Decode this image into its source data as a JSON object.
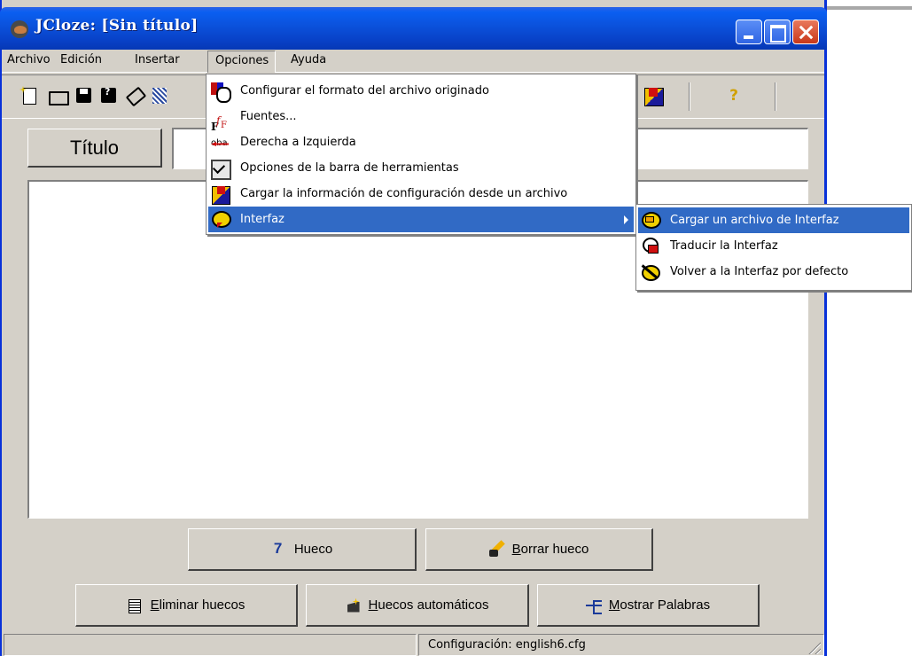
{
  "window": {
    "title": "JCloze: [Sin título]"
  },
  "menubar": {
    "items": [
      "Archivo",
      "Edición",
      "Insertar",
      "Opciones",
      "Ayuda"
    ]
  },
  "toolbar": {
    "help_label": "?"
  },
  "title_field": {
    "label": "Título",
    "value": ""
  },
  "buttons": {
    "hueco": "Hueco",
    "borrar_hueco_key": "B",
    "borrar_hueco_rest": "orrar hueco",
    "eliminar_key": "E",
    "eliminar_rest": "liminar huecos",
    "automaticos_key": "H",
    "automaticos_rest": "uecos automáticos",
    "mostrar_key": "M",
    "mostrar_rest": "ostrar Palabras"
  },
  "statusbar": {
    "left": "",
    "config": "Configuración: english6.cfg"
  },
  "opciones_menu": {
    "items": [
      {
        "label": "Configurar el formato del archivo originado",
        "icon": "format-icon"
      },
      {
        "label": "Fuentes...",
        "icon": "fonts-icon"
      },
      {
        "label": "Derecha a Izquierda",
        "icon": "rtl-icon"
      },
      {
        "label": "Opciones de la barra de herramientas",
        "icon": "toolbar-options-icon"
      },
      {
        "label": "Cargar la información de configuración desde un archivo",
        "icon": "load-config-icon"
      },
      {
        "label": "Interfaz",
        "icon": "interface-icon",
        "highlighted": true
      }
    ]
  },
  "interfaz_submenu": {
    "items": [
      {
        "label": "Cargar un archivo de Interfaz",
        "icon": "load-interface-icon",
        "highlighted": true
      },
      {
        "label": "Traducir la Interfaz",
        "icon": "translate-interface-icon"
      },
      {
        "label": "Volver a la Interfaz por defecto",
        "icon": "default-interface-icon"
      }
    ]
  },
  "colors": {
    "titlebar": "#0a5ff1",
    "menu_highlight": "#316ac5",
    "face": "#d4d0c8"
  }
}
